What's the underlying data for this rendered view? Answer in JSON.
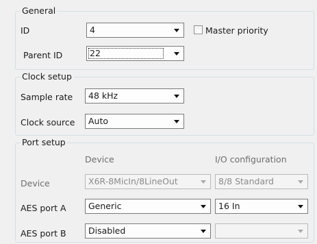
{
  "general": {
    "legend": "General",
    "id_label": "ID",
    "id_value": "4",
    "master_priority_label": "Master priority",
    "master_priority_checked": false,
    "parent_id_label": "Parent ID",
    "parent_id_value": "22"
  },
  "clock": {
    "legend": "Clock setup",
    "sample_rate_label": "Sample rate",
    "sample_rate_value": "48 kHz",
    "clock_source_label": "Clock source",
    "clock_source_value": "Auto"
  },
  "ports": {
    "legend": "Port setup",
    "col_device": "Device",
    "col_io": "I/O configuration",
    "device_label": "Device",
    "device_value": "X6R-8MicIn/8LineOut",
    "device_io_value": "8/8 Standard",
    "aes_a_label": "AES port A",
    "aes_a_value": "Generic",
    "aes_a_io_value": "16 In",
    "aes_b_label": "AES port B",
    "aes_b_value": "Disabled",
    "aes_b_io_value": ""
  }
}
